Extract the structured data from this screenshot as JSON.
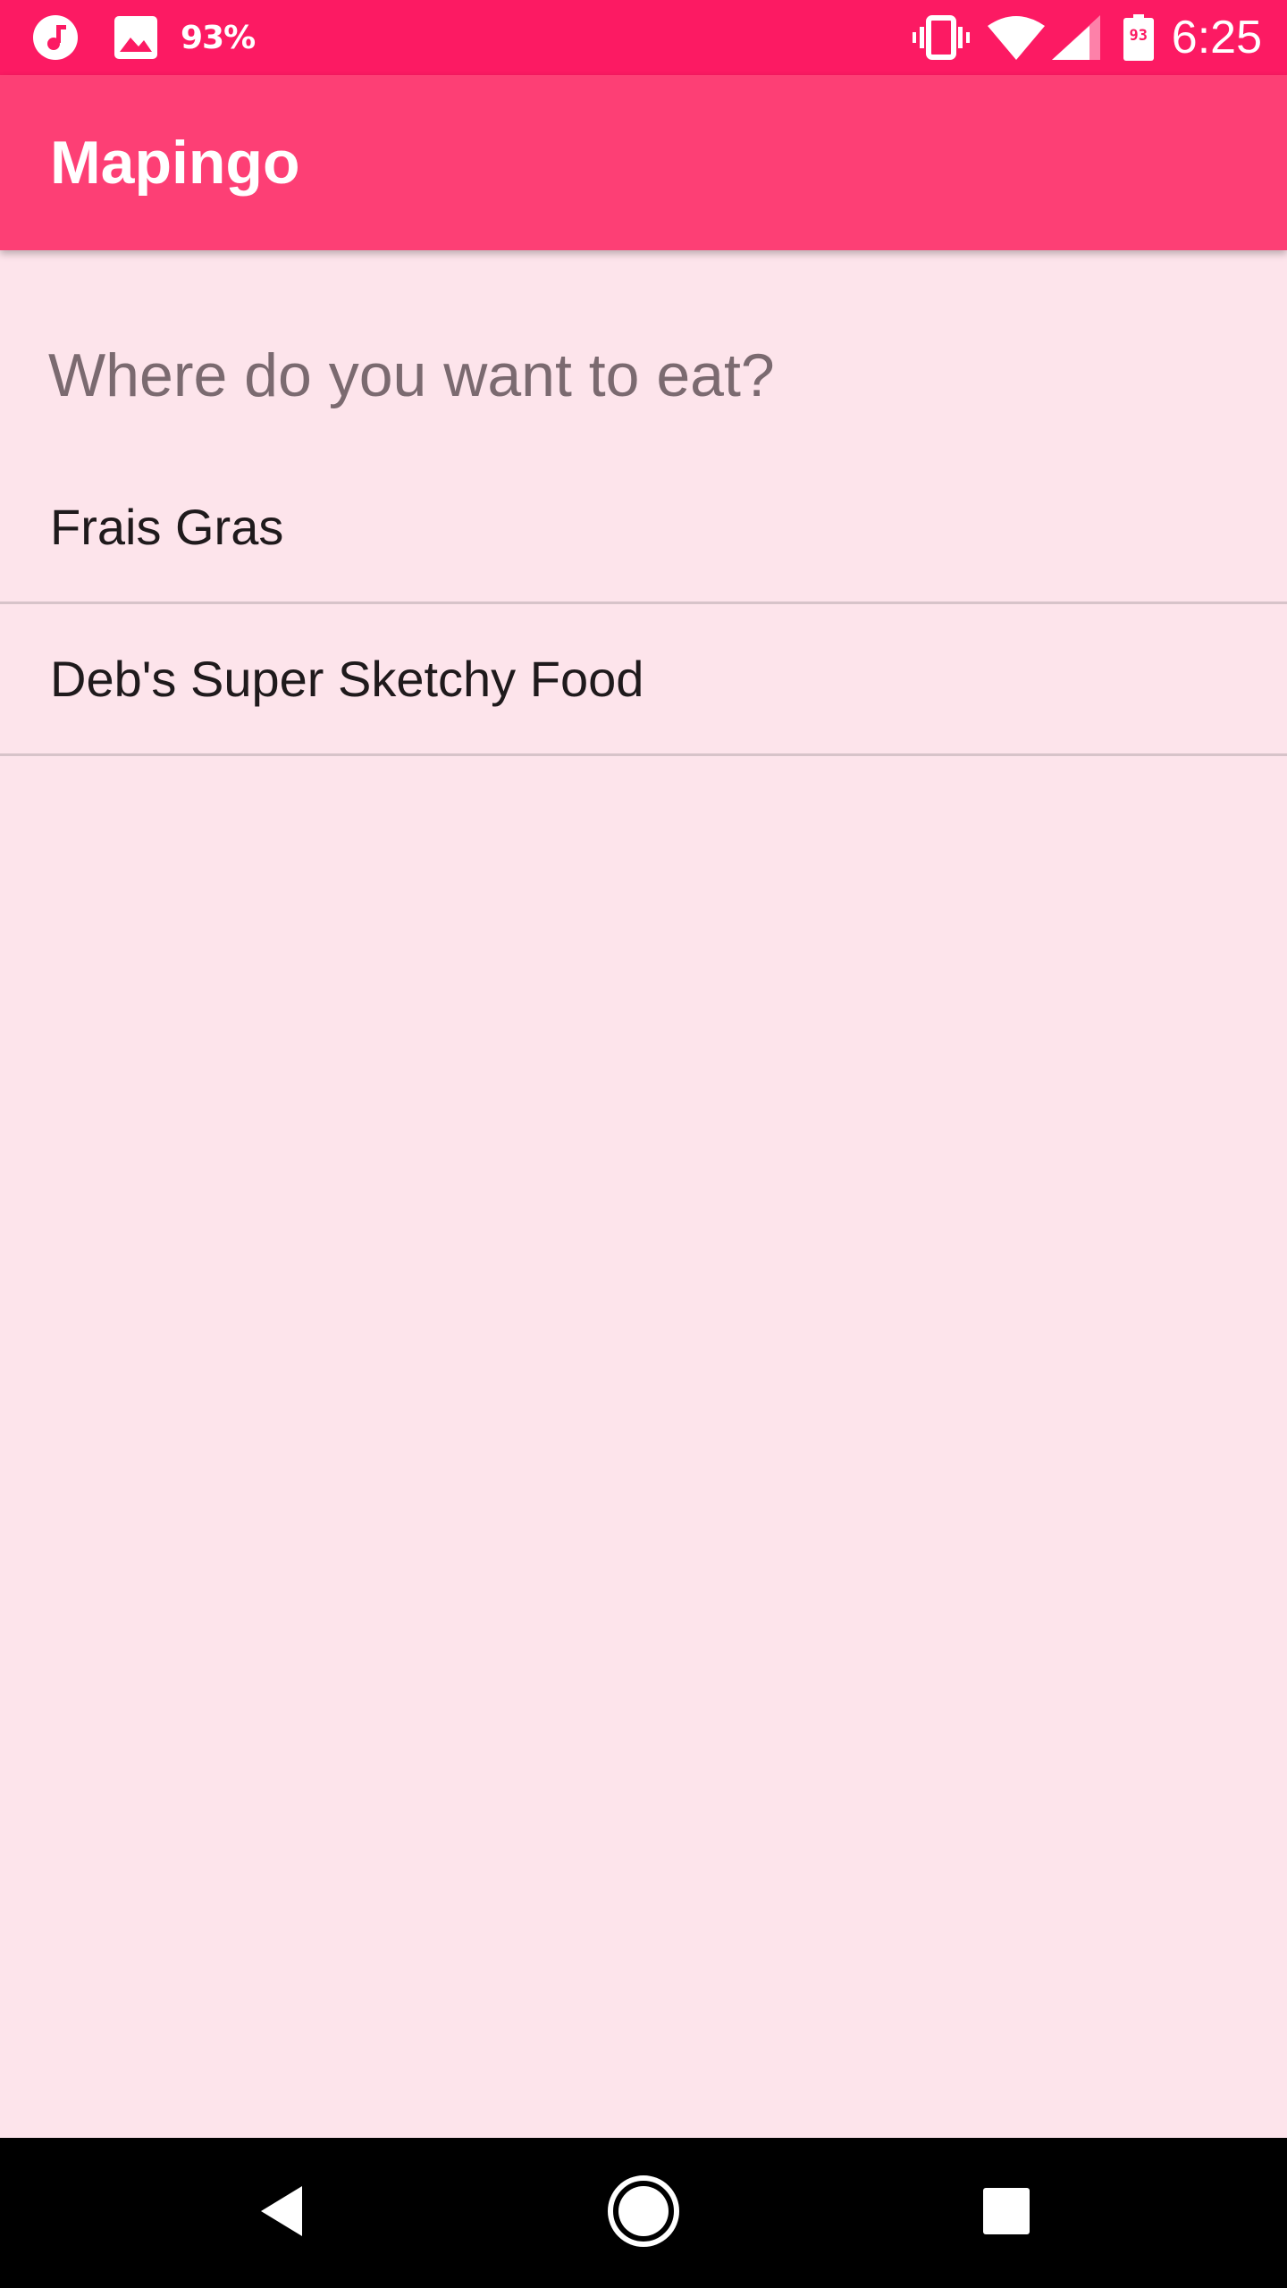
{
  "status_bar": {
    "left_icons": [
      "music-note-icon",
      "image-icon"
    ],
    "left_text": "93%",
    "right_icons": [
      "vibrate-icon",
      "wifi-icon",
      "signal-icon",
      "battery-icon"
    ],
    "battery_level_text": "93",
    "time": "6:25",
    "color": "#fc1a63"
  },
  "app_bar": {
    "title": "Mapingo",
    "color": "#fd3f75"
  },
  "search": {
    "placeholder": "Where do you want to eat?"
  },
  "results": [
    {
      "label": "Frais Gras"
    },
    {
      "label": "Deb's Super Sketchy Food"
    }
  ],
  "nav_bar": {
    "buttons": [
      "back-icon",
      "home-icon",
      "recents-icon"
    ]
  },
  "background_color": "#fde4eb"
}
